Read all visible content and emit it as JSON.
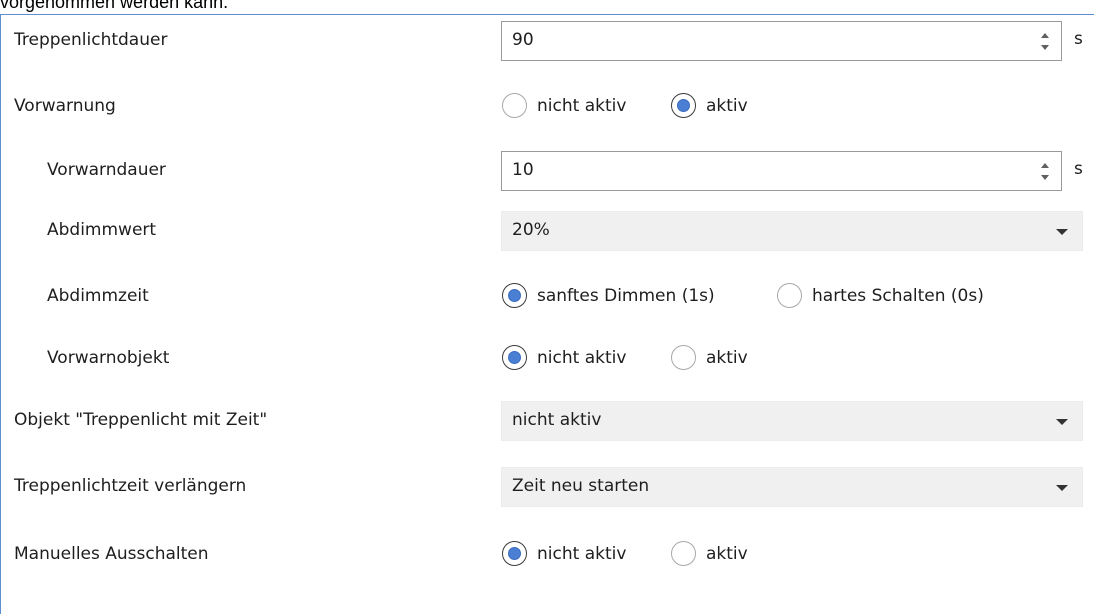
{
  "cutoff_text": "vorgenommen werden kann.",
  "rows": {
    "duration": {
      "label": "Treppenlichtdauer",
      "value": "90",
      "unit": "s"
    },
    "prewarning": {
      "label": "Vorwarnung",
      "options": [
        "nicht aktiv",
        "aktiv"
      ],
      "selected": "aktiv"
    },
    "prewarn_duration": {
      "label": "Vorwarndauer",
      "value": "10",
      "unit": "s"
    },
    "dim_value": {
      "label": "Abdimmwert",
      "value": "20%"
    },
    "dim_time": {
      "label": "Abdimmzeit",
      "options": [
        "sanftes Dimmen (1s)",
        "hartes Schalten (0s)"
      ],
      "selected": "sanftes Dimmen (1s)"
    },
    "prewarn_object": {
      "label": "Vorwarnobjekt",
      "options": [
        "nicht aktiv",
        "aktiv"
      ],
      "selected": "nicht aktiv"
    },
    "object_time": {
      "label": "Objekt \"Treppenlicht mit Zeit\"",
      "value": "nicht aktiv"
    },
    "extend": {
      "label": "Treppenlichtzeit verlängern",
      "value": "Zeit neu starten"
    },
    "manual_off": {
      "label": "Manuelles Ausschalten",
      "options": [
        "nicht aktiv",
        "aktiv"
      ],
      "selected": "nicht aktiv"
    }
  }
}
